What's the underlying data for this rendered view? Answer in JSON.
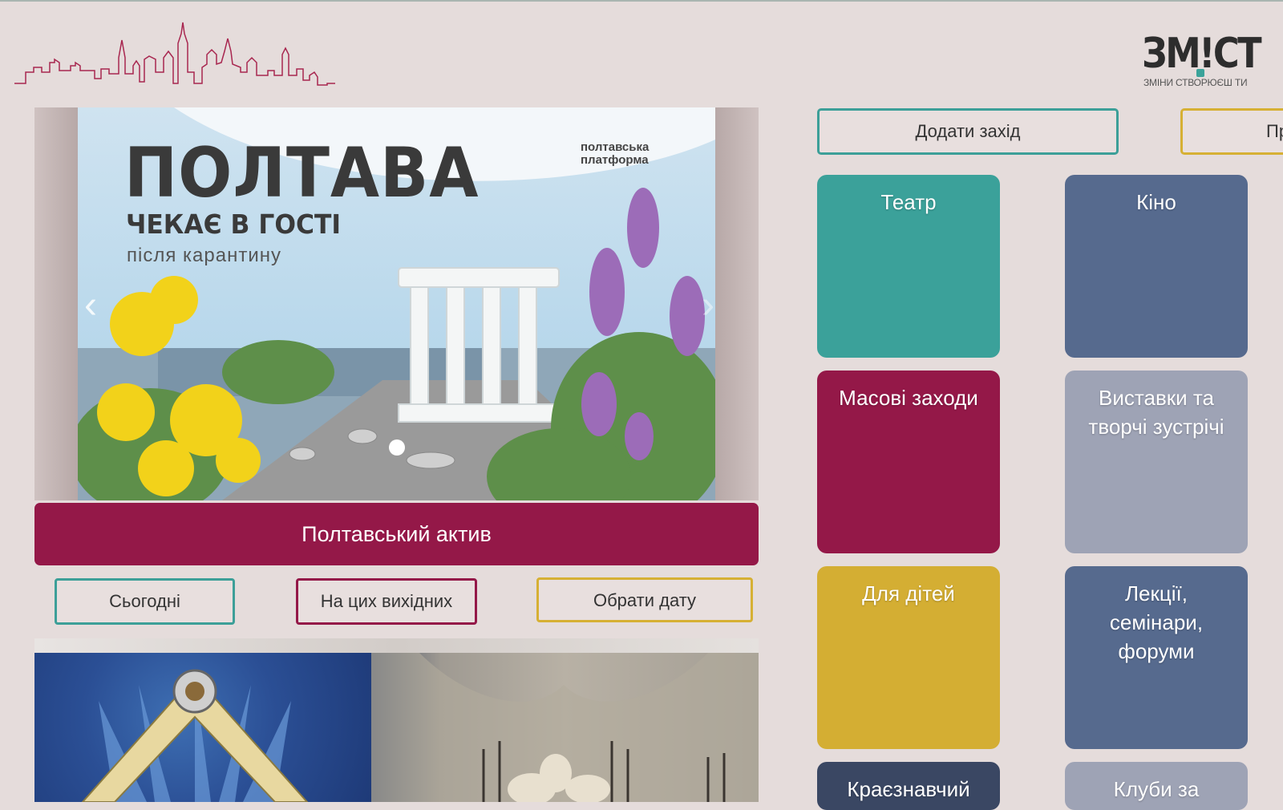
{
  "logo": {
    "text": "ЗМ!СТ",
    "tagline": "ЗМІНИ СТВОРЮЄШ ТИ"
  },
  "slider": {
    "title": "ПОЛТАВА",
    "subtitle": "ЧЕКАЄ В ГОСТІ",
    "subtitle2": "після карантину",
    "brand_line1": "полтавська",
    "brand_line2": "платформа",
    "prev_icon": "‹",
    "next_icon": "›"
  },
  "banner": {
    "label": "Полтавський актив"
  },
  "filters": {
    "today": "Сьогодні",
    "weekend": "На цих вихідних",
    "pick_date": "Обрати дату"
  },
  "actions": {
    "add_event": "Додати захід",
    "cut_button": "Пр"
  },
  "categories": [
    {
      "label": "Театр",
      "color": "#3ba19a"
    },
    {
      "label": "Кіно",
      "color": "#566a8e"
    },
    {
      "label": "Масові заходи",
      "color": "#941848"
    },
    {
      "label": "Виставки та творчі зустрічі",
      "color": "#9ea3b5"
    },
    {
      "label": "Для дітей",
      "color": "#d4ae33"
    },
    {
      "label": "Лекції, семінари, форуми",
      "color": "#566a8e"
    },
    {
      "label": "Краєзнавчий",
      "color": "#3a4763"
    },
    {
      "label": "Клуби за",
      "color": "#9ea3b5"
    }
  ]
}
